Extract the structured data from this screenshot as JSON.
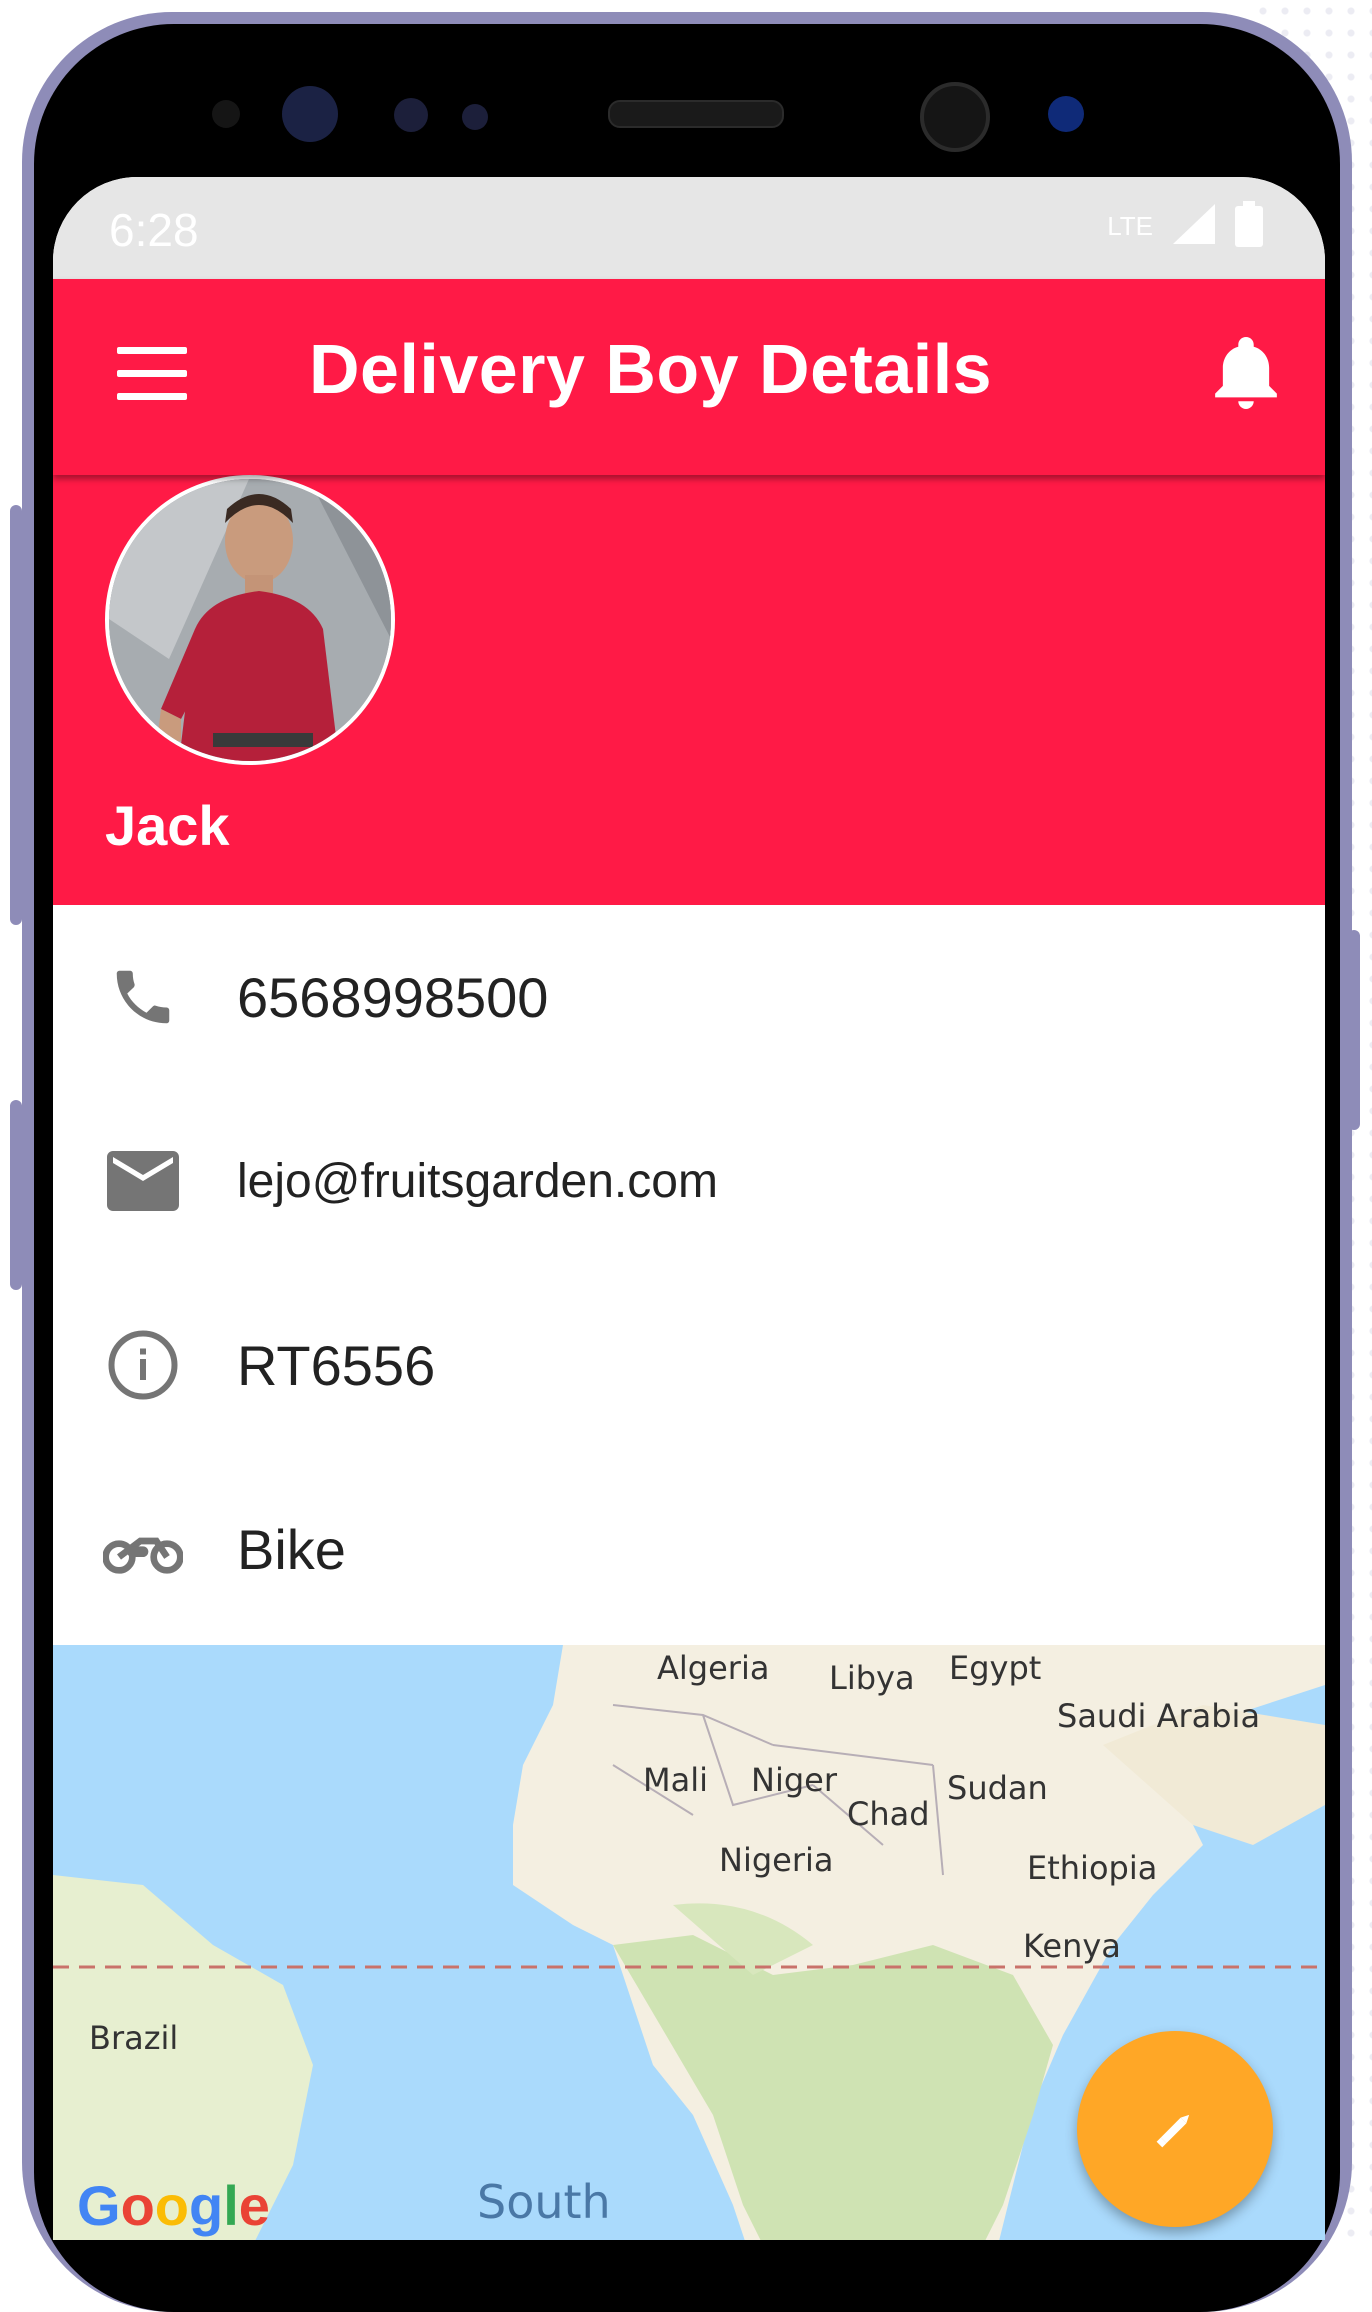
{
  "statusbar": {
    "time": "6:28",
    "network": "LTE"
  },
  "appbar": {
    "title": "Delivery Boy Details",
    "menu_icon": "menu-icon",
    "bell_icon": "bell-icon"
  },
  "profile": {
    "name": "Jack",
    "avatar_icon": "avatar"
  },
  "details": {
    "phone": "6568998500",
    "email": "lejo@fruitsgarden.com",
    "id": "RT6556",
    "vehicle": "Bike"
  },
  "map": {
    "labels": {
      "algeria": "Algeria",
      "libya": "Libya",
      "egypt": "Egypt",
      "saudi": "Saudi Arabia",
      "mali": "Mali",
      "niger": "Niger",
      "sudan": "Sudan",
      "chad": "Chad",
      "nigeria": "Nigeria",
      "ethiopia": "Ethiopia",
      "kenya": "Kenya",
      "brazil": "Brazil",
      "south": "South"
    },
    "brand": "Google"
  },
  "colors": {
    "accent": "#ff1a46",
    "fab": "#ffa726",
    "water": "#aadafc",
    "land": "#f4efe1"
  },
  "fab": {
    "icon": "pencil-icon"
  }
}
